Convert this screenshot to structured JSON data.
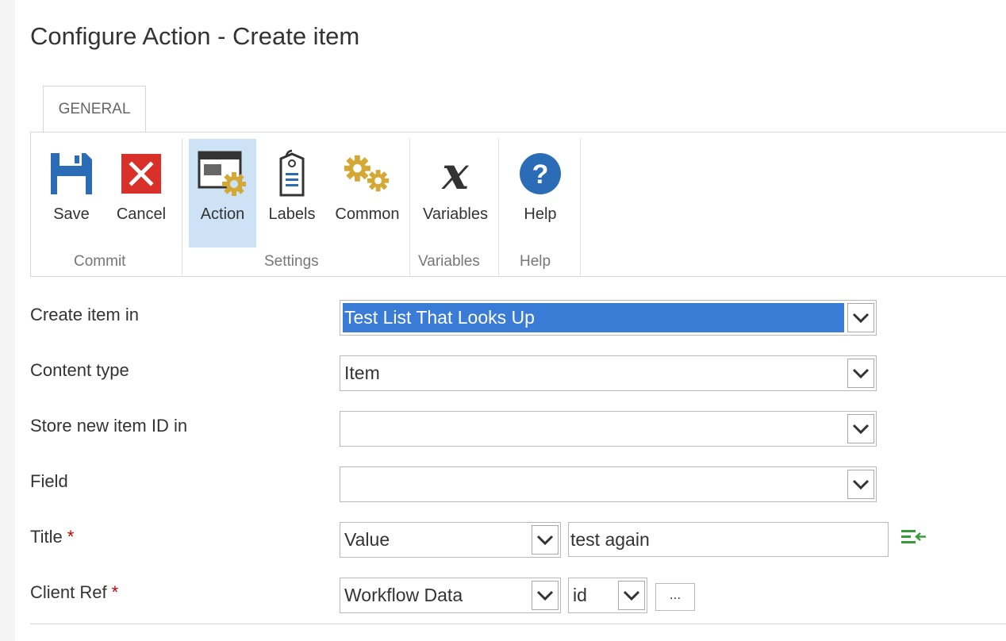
{
  "page": {
    "title": "Configure Action - Create item"
  },
  "ribbon": {
    "tab_label": "GENERAL",
    "buttons": {
      "save": "Save",
      "cancel": "Cancel",
      "action": "Action",
      "labels": "Labels",
      "common": "Common",
      "variables": "Variables",
      "help": "Help"
    },
    "groups": {
      "commit": "Commit",
      "settings": "Settings",
      "variables": "Variables",
      "help": "Help"
    }
  },
  "form": {
    "create_item_in": {
      "label": "Create item in",
      "value": "Test List That Looks Up"
    },
    "content_type": {
      "label": "Content type",
      "value": "Item"
    },
    "store_id": {
      "label": "Store new item ID in",
      "value": ""
    },
    "field": {
      "label": "Field",
      "value": ""
    },
    "title": {
      "label": "Title",
      "required": "*",
      "type_value": "Value",
      "text_value": "test again"
    },
    "client_ref": {
      "label": "Client Ref",
      "required": "*",
      "source_value": "Workflow Data",
      "field_value": "id",
      "ellipsis": "..."
    }
  },
  "icons": {
    "save": "floppy-disk-icon",
    "cancel": "red-x-icon",
    "action": "window-gear-icon",
    "labels": "tag-icon",
    "common": "gears-icon",
    "variables": "italic-x-icon",
    "help": "question-circle-icon",
    "dropdown": "chevron-down-icon",
    "insert_reference": "insert-reference-icon"
  },
  "colors": {
    "selection": "#3a7bd5",
    "ribbon_active": "#cde3f5",
    "save_blue": "#2a6cb5",
    "cancel_red": "#d9302a",
    "gear_gold": "#d4a834",
    "help_blue": "#2a6cb5",
    "required": "#c00000",
    "insert_green": "#3a9a3a"
  }
}
